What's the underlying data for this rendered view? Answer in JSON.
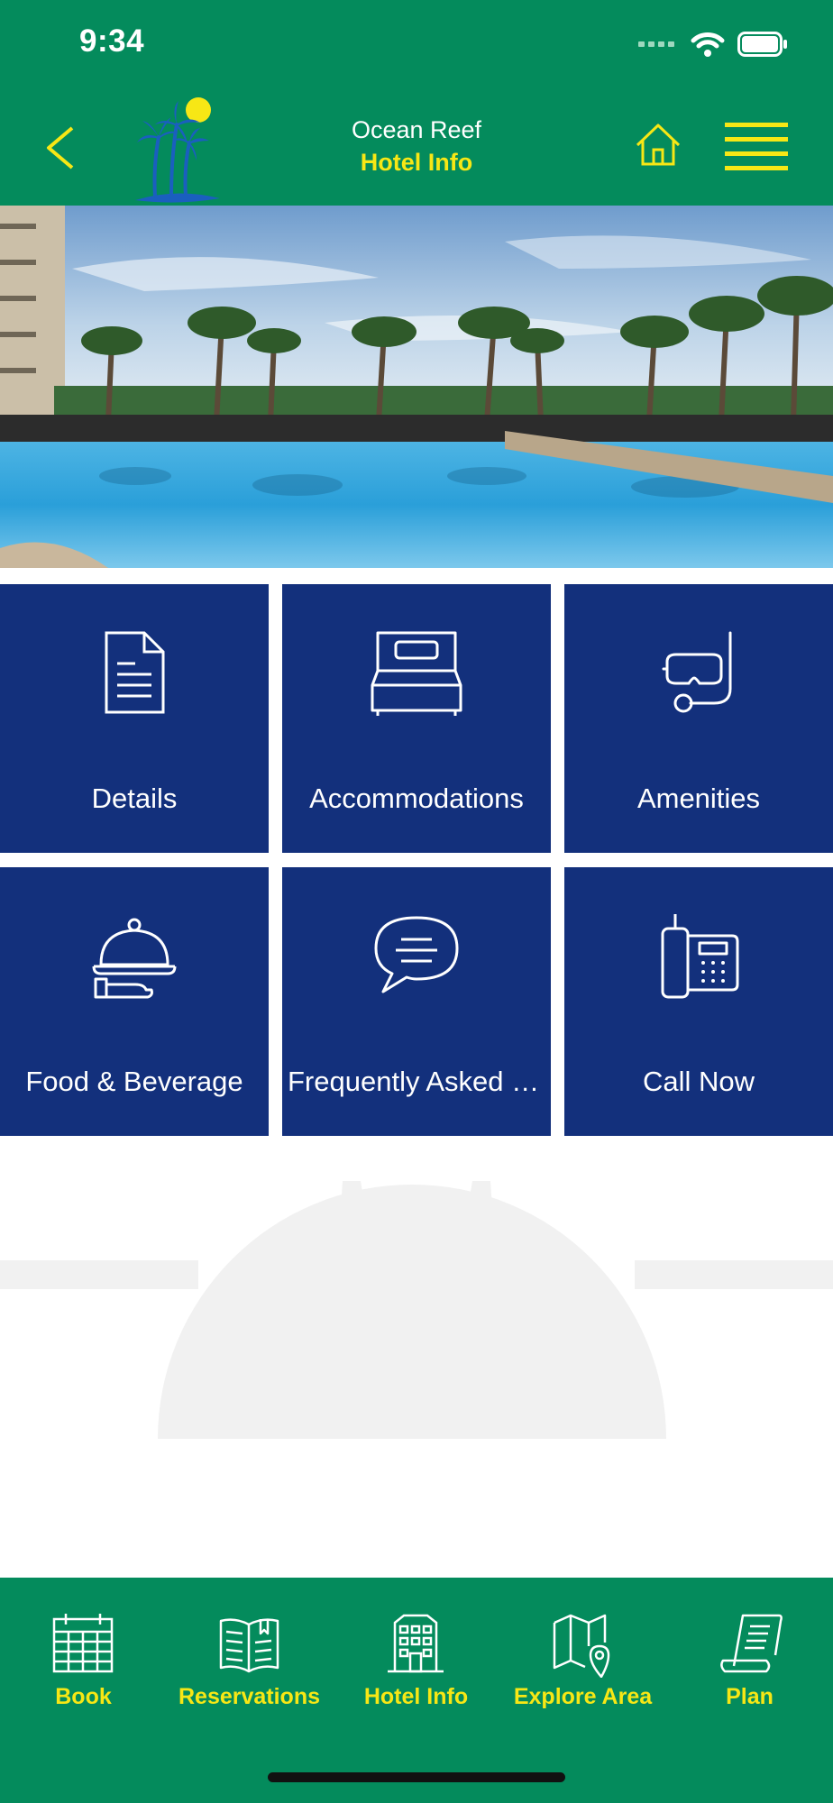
{
  "status": {
    "time": "9:34"
  },
  "header": {
    "subtitle": "Ocean Reef",
    "title": "Hotel Info",
    "back_icon": "chevron-left-icon",
    "home_icon": "house-icon",
    "menu_icon": "hamburger-menu-icon",
    "logo": "palm-tree-sun-logo"
  },
  "tiles": [
    {
      "label": "Details",
      "icon": "document-icon"
    },
    {
      "label": "Accommodations",
      "icon": "bed-icon"
    },
    {
      "label": "Amenities",
      "icon": "snorkel-mask-icon"
    },
    {
      "label": "Food & Beverage",
      "icon": "cloche-icon"
    },
    {
      "label": "Frequently Asked Q...",
      "icon": "chat-bubble-icon"
    },
    {
      "label": "Call Now",
      "icon": "desk-phone-icon"
    }
  ],
  "tabbar": [
    {
      "label": "Book",
      "icon": "calendar-icon"
    },
    {
      "label": "Reservations",
      "icon": "open-book-icon"
    },
    {
      "label": "Hotel Info",
      "icon": "hotel-building-icon"
    },
    {
      "label": "Explore Area",
      "icon": "map-pin-icon"
    },
    {
      "label": "Plan",
      "icon": "scroll-list-icon"
    }
  ],
  "colors": {
    "header_green": "#048B5C",
    "accent_yellow": "#F7E715",
    "tile_navy": "#13307C"
  }
}
